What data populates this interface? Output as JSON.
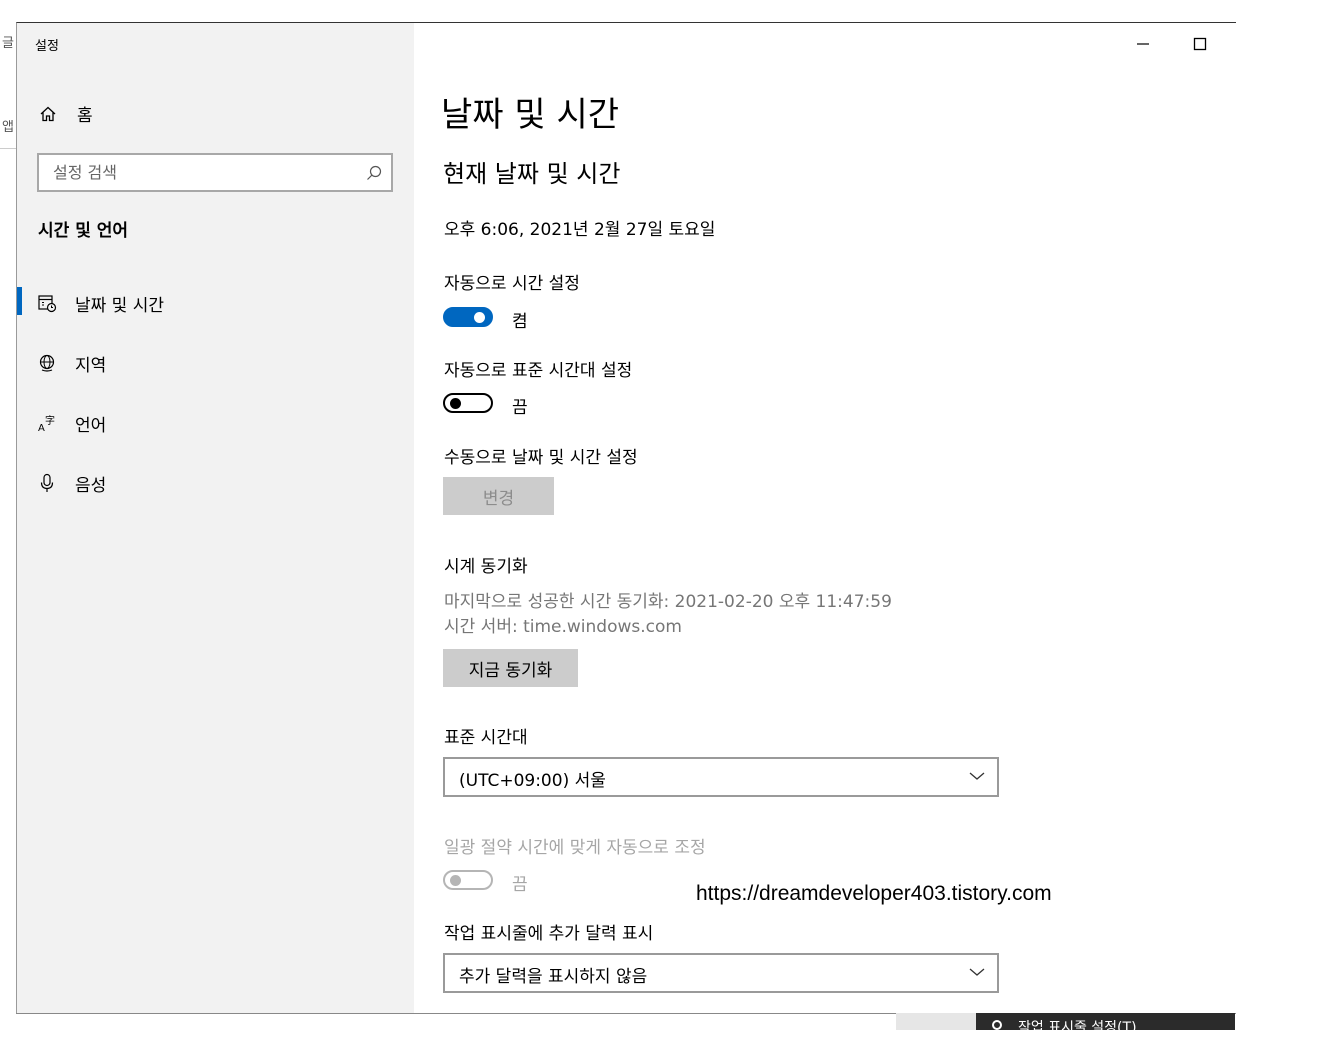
{
  "background_window": {
    "fragment_top": "글",
    "fragment_mid": "앱"
  },
  "app": {
    "title": "설정"
  },
  "window_controls": {
    "minimize_icon": "minimize-icon",
    "maximize_icon": "maximize-icon"
  },
  "sidebar": {
    "home_label": "홈",
    "search_placeholder": "설정 검색",
    "section_title": "시간 및 언어",
    "items": [
      {
        "label": "날짜 및 시간",
        "icon": "calendar-clock-icon",
        "selected": true
      },
      {
        "label": "지역",
        "icon": "globe-icon",
        "selected": false
      },
      {
        "label": "언어",
        "icon": "language-icon",
        "selected": false
      },
      {
        "label": "음성",
        "icon": "microphone-icon",
        "selected": false
      }
    ]
  },
  "main": {
    "page_title": "날짜 및 시간",
    "current_heading": "현재 날짜 및 시간",
    "current_datetime": "오후 6:06, 2021년 2월 27일 토요일",
    "auto_time_label": "자동으로 시간 설정",
    "auto_time_state": "켬",
    "auto_timezone_label": "자동으로 표준 시간대 설정",
    "auto_timezone_state": "끔",
    "manual_label": "수동으로 날짜 및 시간 설정",
    "change_button": "변경",
    "sync_heading": "시계 동기화",
    "last_sync": "마지막으로 성공한 시간 동기화: 2021-02-20 오후 11:47:59",
    "time_server": "시간 서버: time.windows.com",
    "sync_now_button": "지금 동기화",
    "timezone_label": "표준 시간대",
    "timezone_value": "(UTC+09:00) 서울",
    "dst_label": "일광 절약 시간에 맞게 자동으로 조정",
    "dst_state": "끔",
    "calendar_label": "작업 표시줄에 추가 달력 표시",
    "calendar_value": "추가 달력을 표시하지 않음"
  },
  "watermark": "https://dreamdeveloper403.tistory.com",
  "taskbar_popup": {
    "label": "작업 표시줄 설정(T)"
  },
  "colors": {
    "accent": "#0067c0",
    "sidebar_bg": "#f2f2f2",
    "button_bg": "#cccccc"
  }
}
